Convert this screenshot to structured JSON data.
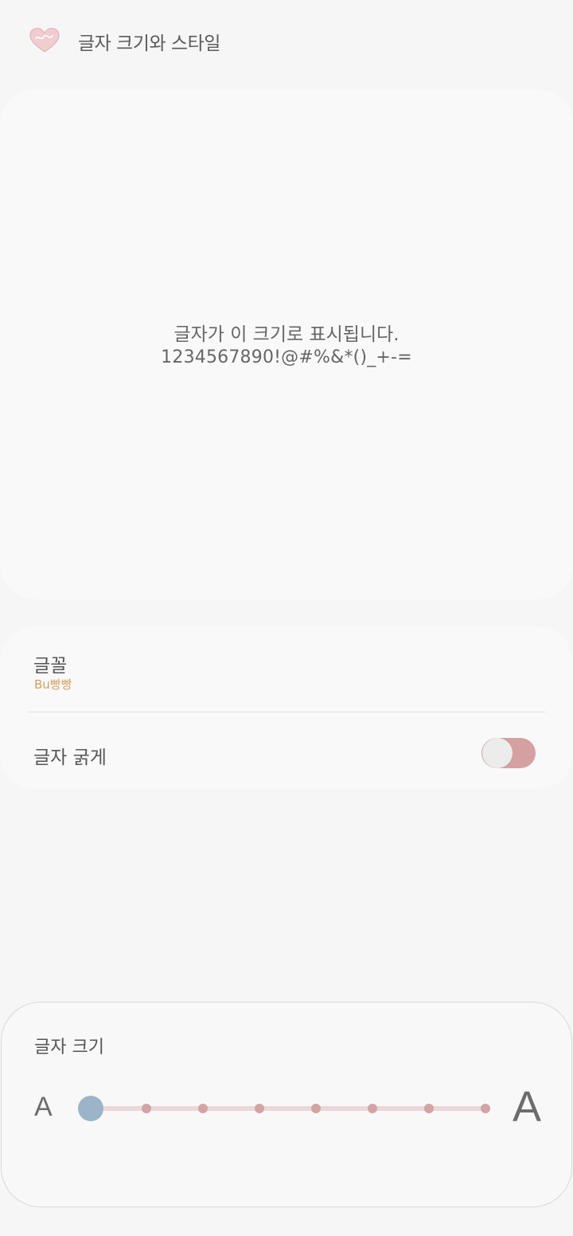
{
  "header": {
    "title": "글자 크기와 스타일",
    "back_icon": "heart-back-icon"
  },
  "preview": {
    "line1": "글자가 이 크기로 표시됩니다.",
    "line2": "1234567890!@#%&*()_+-="
  },
  "settings": {
    "font": {
      "title": "글꼴",
      "value": "Bu빵빵"
    },
    "bold": {
      "label": "글자 굵게",
      "enabled": false
    }
  },
  "font_size": {
    "label": "글자 크기",
    "small_glyph": "A",
    "large_glyph": "A",
    "steps": 8,
    "selected_index": 0
  },
  "colors": {
    "accent": "#d4a0a1",
    "slider_thumb": "#9bb4c8",
    "font_value": "#d4a25f",
    "background": "#f6f6f6"
  }
}
